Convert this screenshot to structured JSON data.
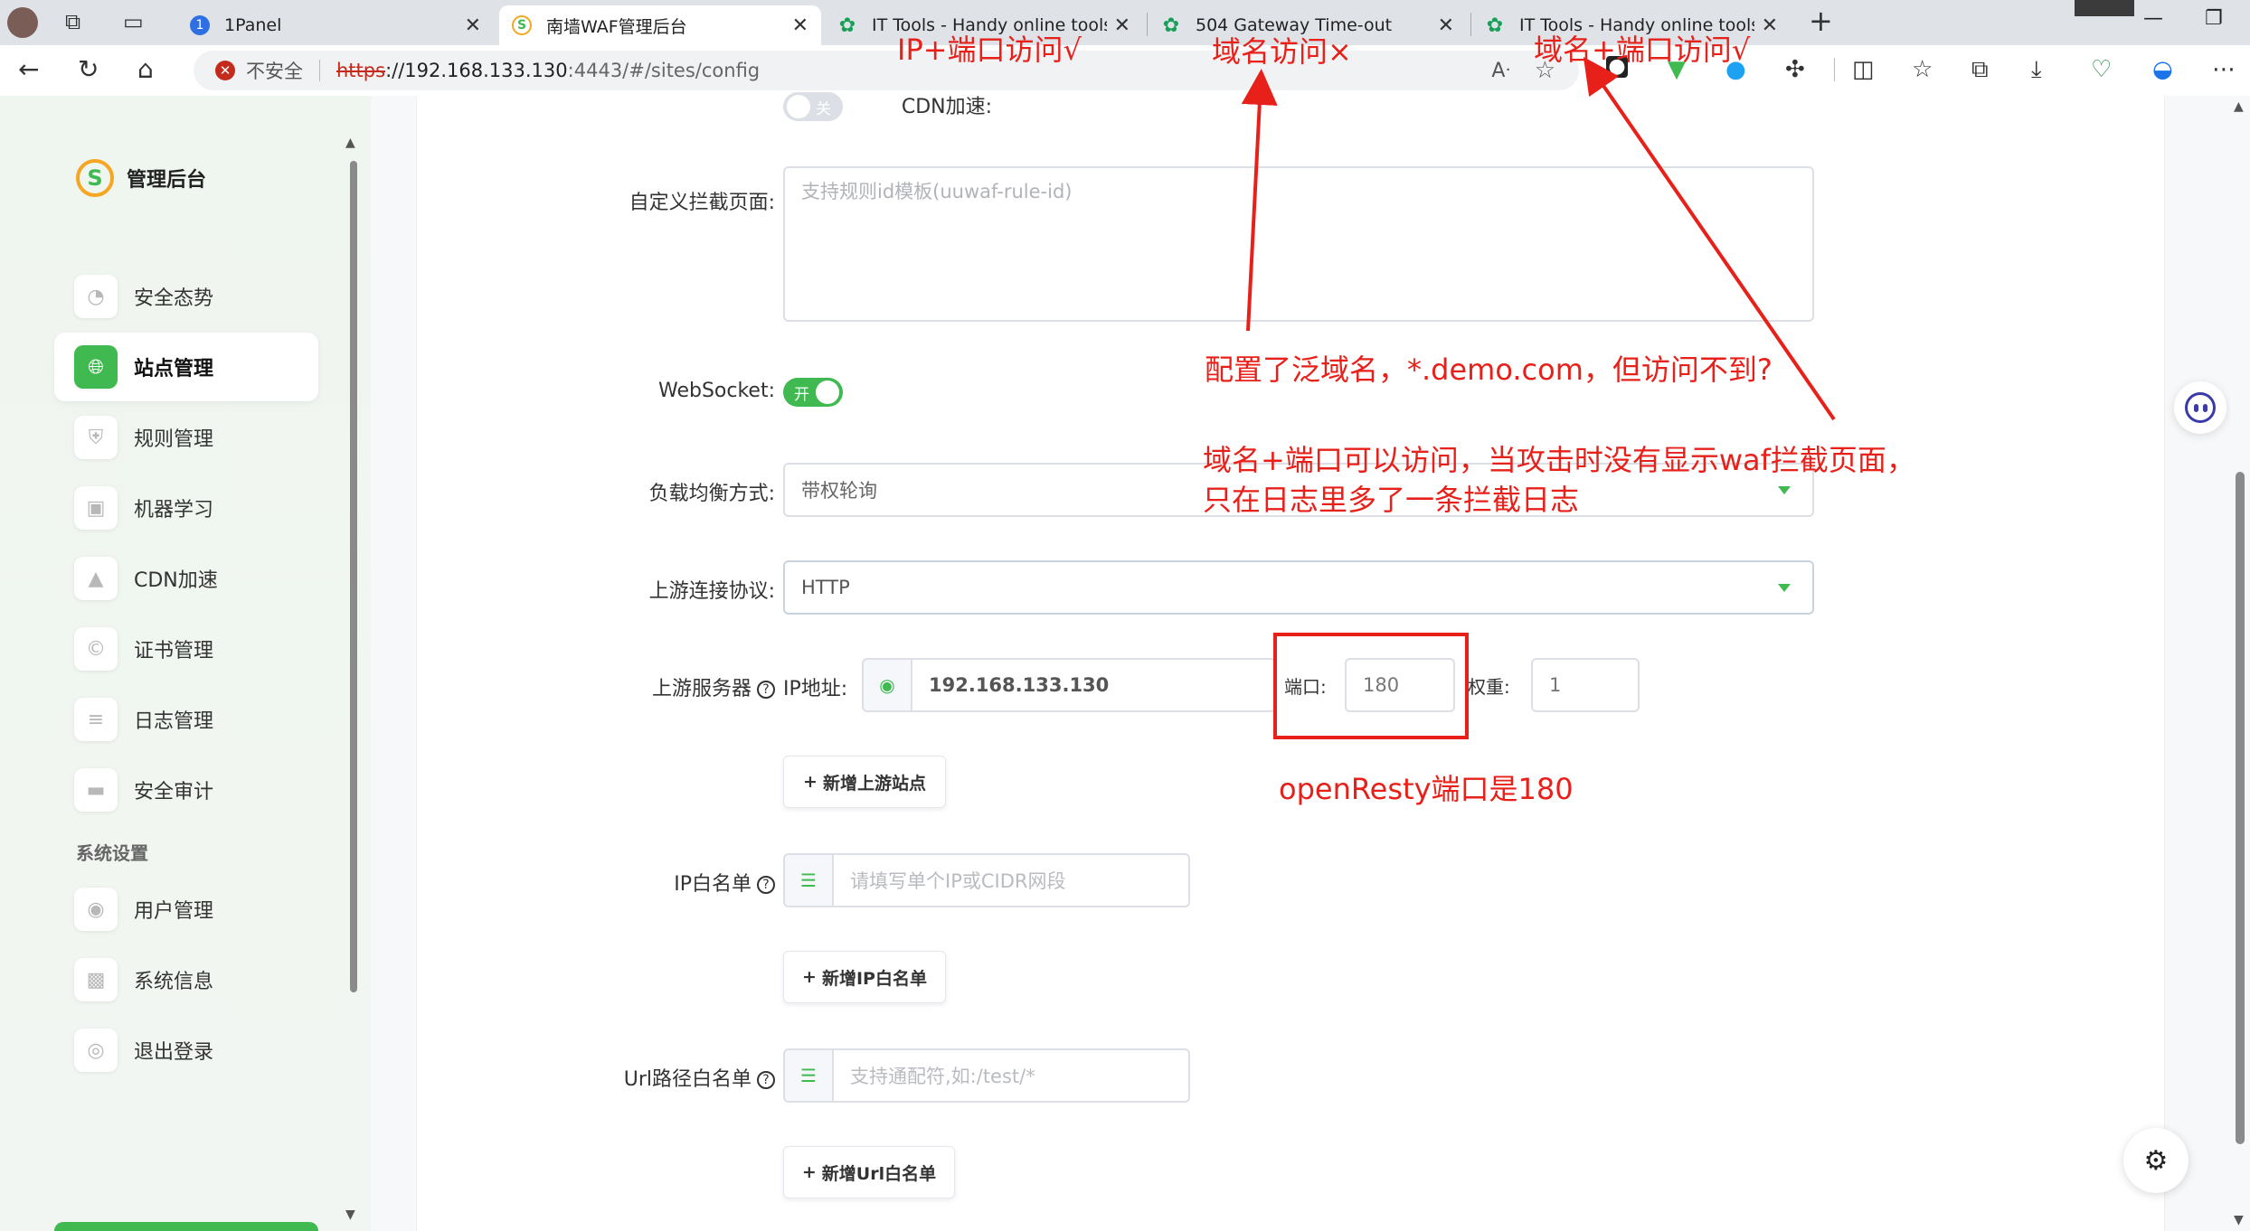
{
  "browser": {
    "tabs": [
      {
        "title": "1Panel",
        "icon": "1panel-icon",
        "active": false
      },
      {
        "title": "南墙WAF管理后台",
        "icon": "nanqiang-waf-icon",
        "active": true
      },
      {
        "title": "IT Tools - Handy online tools for",
        "icon": "it-tools-icon",
        "active": false
      },
      {
        "title": "504 Gateway Time-out",
        "icon": "it-tools-icon",
        "active": false
      },
      {
        "title": "IT Tools - Handy online tools for",
        "icon": "it-tools-icon",
        "active": false
      }
    ],
    "new_tab_glyph": "+",
    "address": {
      "security_label": "不安全",
      "scheme": "https",
      "host": "://192.168.133.130",
      "path": ":4443/#/sites/config"
    }
  },
  "sidebar": {
    "brand": "管理后台",
    "brand_logo_letter": "S",
    "items": [
      {
        "label": "安全态势",
        "icon": "dashboard-icon",
        "active": false
      },
      {
        "label": "站点管理",
        "icon": "globe-icon",
        "active": true
      },
      {
        "label": "规则管理",
        "icon": "shield-icon",
        "active": false
      },
      {
        "label": "机器学习",
        "icon": "robot-icon",
        "active": false
      },
      {
        "label": "CDN加速",
        "icon": "rocket-icon",
        "active": false
      },
      {
        "label": "证书管理",
        "icon": "certificate-icon",
        "active": false
      },
      {
        "label": "日志管理",
        "icon": "database-icon",
        "active": false
      },
      {
        "label": "安全审计",
        "icon": "monitor-icon",
        "active": false
      }
    ],
    "section_title": "系统设置",
    "system_items": [
      {
        "label": "用户管理",
        "icon": "user-icon"
      },
      {
        "label": "系统信息",
        "icon": "chip-icon"
      },
      {
        "label": "退出登录",
        "icon": "logout-icon"
      }
    ]
  },
  "form": {
    "cdn_label": "CDN加速:",
    "cdn_toggle_text": "关",
    "custom_block_label": "自定义拦截页面:",
    "custom_block_placeholder": "支持规则id模板(uuwaf-rule-id)",
    "websocket_label": "WebSocket:",
    "websocket_toggle_text": "开",
    "lb_label": "负载均衡方式:",
    "lb_value": "带权轮询",
    "proto_label": "上游连接协议:",
    "proto_value": "HTTP",
    "upstream_label": "上游服务器",
    "ip_label": "IP地址:",
    "ip_value": "192.168.133.130",
    "port_label": "端口:",
    "port_value": "180",
    "weight_label": "权重:",
    "weight_value": "1",
    "add_upstream": "新增上游站点",
    "ip_whitelist_label": "IP白名单",
    "ip_whitelist_placeholder": "请填写单个IP或CIDR网段",
    "add_ip_whitelist": "新增IP白名单",
    "url_whitelist_label": "Url路径白名单",
    "url_whitelist_placeholder": "支持通配符,如:/test/*",
    "add_url_whitelist": "新增Url白名单"
  },
  "annotations": {
    "ip_port_ok": "IP+端口访问√",
    "domain_fail": "域名访问×",
    "domain_port_ok": "域名+端口访问√",
    "wildcard_note": "配置了泛域名，*.demo.com，但访问不到?",
    "waf_note_line1": "域名+端口可以访问，当攻击时没有显示waf拦截页面，",
    "waf_note_line2": "只在日志里多了一条拦截日志",
    "openresty_note": "openResty端口是180",
    "color": "#e8201a"
  },
  "theme": {
    "accent": "#3fb950",
    "danger": "#c42b1c"
  }
}
